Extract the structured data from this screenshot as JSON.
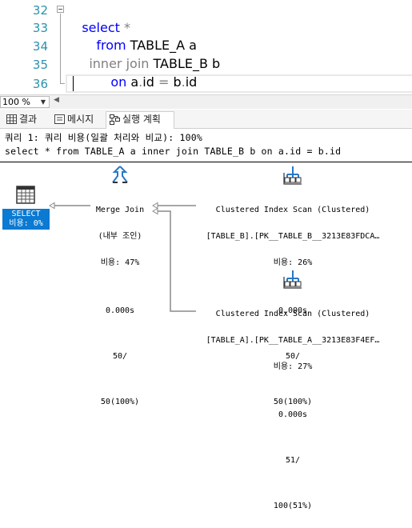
{
  "editor": {
    "lines": [
      {
        "num": "32",
        "t1": "select",
        "t2": " *"
      },
      {
        "num": "33",
        "t1": "from",
        "t2": " TABLE_A a"
      },
      {
        "num": "34",
        "t1": "inner join",
        "t2": " TABLE_B b"
      },
      {
        "num": "35",
        "t1": "on",
        "t2": " a",
        "t3": ".",
        "t4": "id ",
        "t5": "=",
        "t6": " b",
        "t7": ".",
        "t8": "id"
      },
      {
        "num": "36"
      }
    ]
  },
  "zoom": {
    "value": "100 %"
  },
  "tabs": [
    {
      "label": "결과",
      "icon": "grid-icon"
    },
    {
      "label": "메시지",
      "icon": "message-icon"
    },
    {
      "label": "실행 계획",
      "icon": "execution-plan-icon",
      "active": true
    }
  ],
  "plan": {
    "query_title": "쿼리 1: 쿼리 비용(일괄 처리와 비교): 100%",
    "query_text": "select * from TABLE_A a inner join TABLE_B b on a.id = b.id",
    "select_node": {
      "label": "SELECT",
      "cost": "비용: 0%",
      "icon": "result-table-icon"
    },
    "merge_join": {
      "name": "Merge Join",
      "subtitle": "(내부 조인)",
      "cost": "비용: 47%",
      "time": "0.000s",
      "rows": "50/",
      "rows_pct": "50(100%)",
      "icon": "merge-join-icon"
    },
    "scan_b": {
      "name": "Clustered Index Scan (Clustered)",
      "object": "[TABLE_B].[PK__TABLE_B__3213E83FDCA…",
      "cost": "비용: 26%",
      "time": "0.000s",
      "rows": "50/",
      "rows_pct": "50(100%)",
      "icon": "clustered-index-scan-icon"
    },
    "scan_a": {
      "name": "Clustered Index Scan (Clustered)",
      "object": "[TABLE_A].[PK__TABLE_A__3213E83F4EF…",
      "cost": "비용: 27%",
      "time": "0.000s",
      "rows": "51/",
      "rows_pct": "100(51%)",
      "icon": "clustered-index-scan-icon"
    }
  },
  "colors": {
    "keyword": "#0000ff",
    "line_number": "#2b91af",
    "select_highlight": "#0a7ad2"
  }
}
